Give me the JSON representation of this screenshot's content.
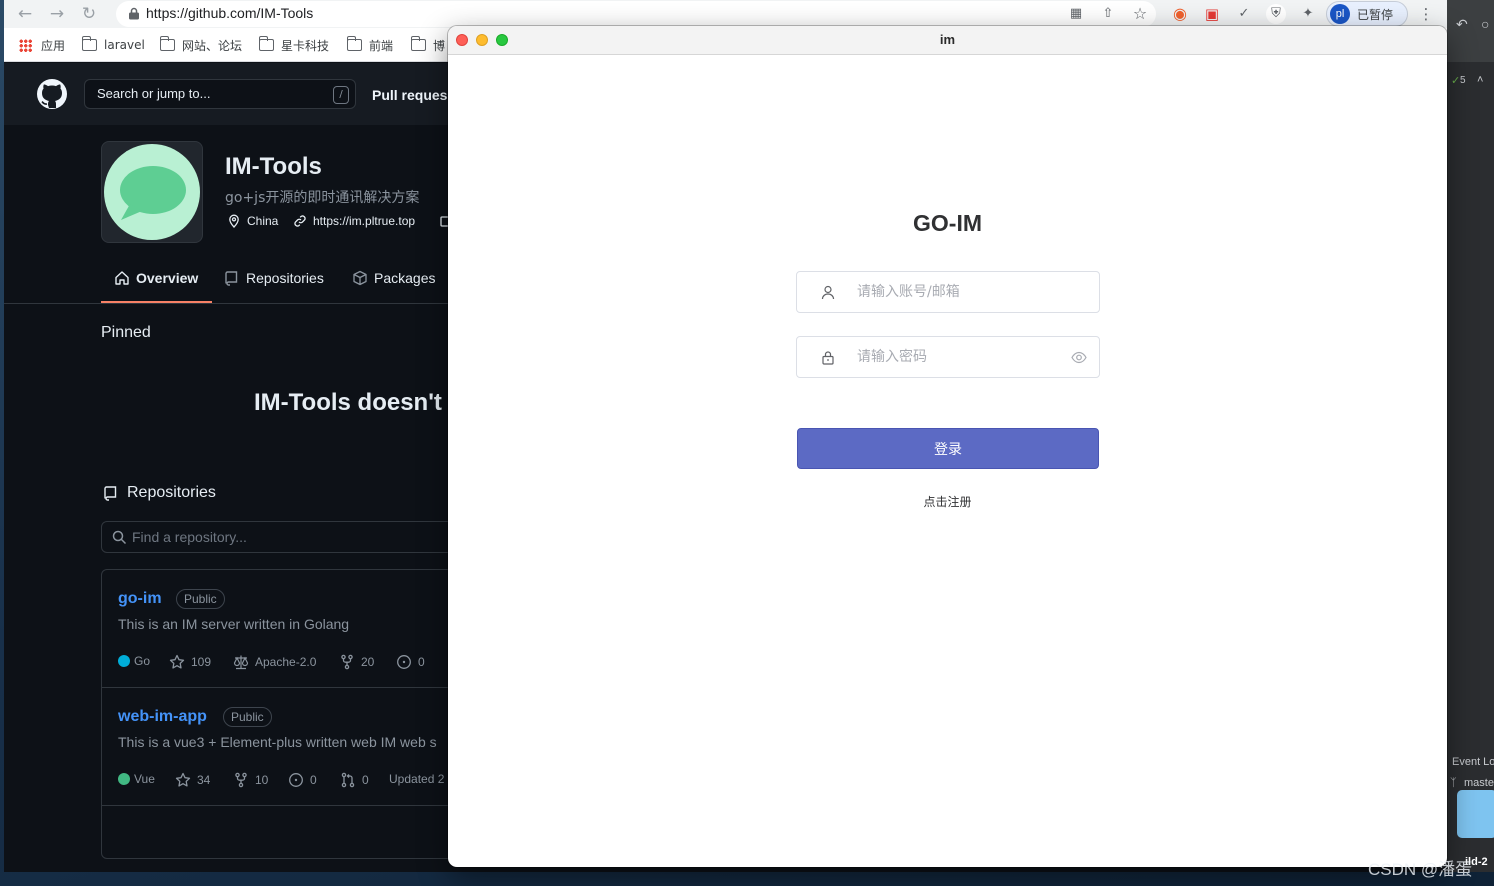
{
  "browser": {
    "url": "https://github.com/IM-Tools",
    "profile_initials": "pl",
    "profile_status": "已暂停",
    "bookmarks": [
      "应用",
      "laravel",
      "网站、论坛",
      "星卡科技",
      "前端",
      "博"
    ]
  },
  "github": {
    "search_placeholder": "Search or jump to...",
    "search_shortcut": "/",
    "nav_pull": "Pull reques",
    "org": {
      "name": "IM-Tools",
      "description": "go+js开源的即时通讯解决方案",
      "location": "China",
      "website": "https://im.pltrue.top"
    },
    "tabs": [
      "Overview",
      "Repositories",
      "Packages"
    ],
    "pinned_title": "Pinned",
    "pinned_empty": "IM-Tools doesn't h",
    "repos_title": "Repositories",
    "repo_search_placeholder": "Find a repository...",
    "repos": [
      {
        "name": "go-im",
        "visibility": "Public",
        "description": "This is an IM server written in Golang",
        "language": "Go",
        "language_color": "#00add8",
        "stars": "109",
        "license": "Apache-2.0",
        "forks": "20",
        "issues": "0"
      },
      {
        "name": "web-im-app",
        "visibility": "Public",
        "description": "This is a vue3 + Element-plus written web IM web s",
        "language": "Vue",
        "language_color": "#41b883",
        "stars": "34",
        "forks": "10",
        "issues": "0",
        "pulls": "0",
        "updated": "Updated 2"
      }
    ]
  },
  "ide": {
    "badge_count": "5",
    "event_log": "Event Lo",
    "branch": "maste",
    "status_text": "ild-2"
  },
  "app_window": {
    "title": "im",
    "heading": "GO-IM",
    "account_placeholder": "请输入账号/邮箱",
    "password_placeholder": "请输入密码",
    "login_label": "登录",
    "register_label": "点击注册",
    "accent_color": "#5c6ac4"
  },
  "watermark": "CSDN @潘蛋"
}
